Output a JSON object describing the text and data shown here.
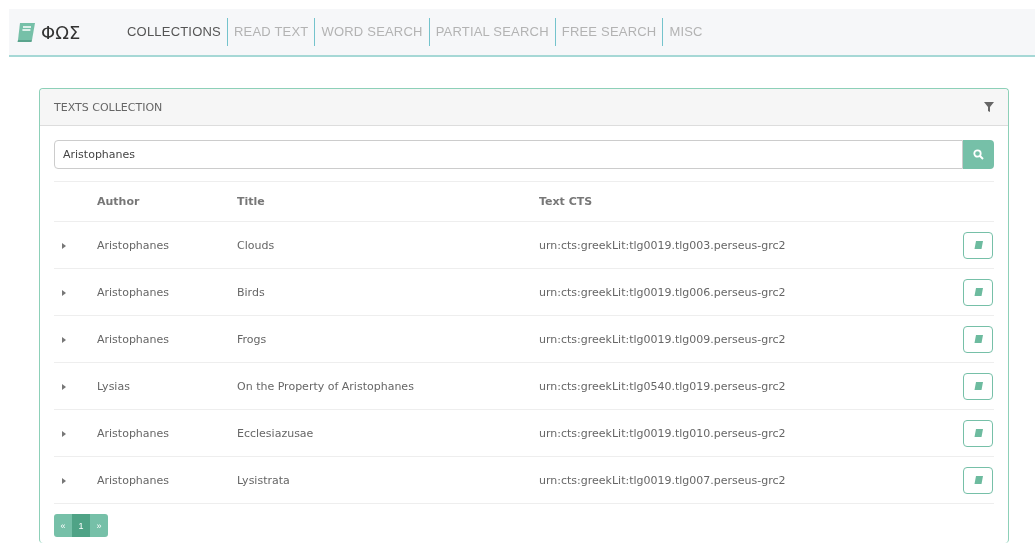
{
  "brand": {
    "title": "ΦΩΣ"
  },
  "nav": [
    {
      "label": "COLLECTIONS",
      "selected": true
    },
    {
      "label": "READ TEXT",
      "selected": false
    },
    {
      "label": "WORD SEARCH",
      "selected": false
    },
    {
      "label": "PARTIAL SEARCH",
      "selected": false
    },
    {
      "label": "FREE SEARCH",
      "selected": false
    },
    {
      "label": "MISC",
      "selected": false
    }
  ],
  "panel": {
    "title": "TEXTS COLLECTION"
  },
  "search": {
    "value": "Aristophanes"
  },
  "table": {
    "columns": [
      "Author",
      "Title",
      "Text CTS"
    ],
    "rows": [
      {
        "author": "Aristophanes",
        "title": "Clouds",
        "cts": "urn:cts:greekLit:tlg0019.tlg003.perseus-grc2"
      },
      {
        "author": "Aristophanes",
        "title": "Birds",
        "cts": "urn:cts:greekLit:tlg0019.tlg006.perseus-grc2"
      },
      {
        "author": "Aristophanes",
        "title": "Frogs",
        "cts": "urn:cts:greekLit:tlg0019.tlg009.perseus-grc2"
      },
      {
        "author": "Lysias",
        "title": "On the Property of Aristophanes",
        "cts": "urn:cts:greekLit:tlg0540.tlg019.perseus-grc2"
      },
      {
        "author": "Aristophanes",
        "title": "Ecclesiazusae",
        "cts": "urn:cts:greekLit:tlg0019.tlg010.perseus-grc2"
      },
      {
        "author": "Aristophanes",
        "title": "Lysistrata",
        "cts": "urn:cts:greekLit:tlg0019.tlg007.perseus-grc2"
      }
    ]
  },
  "pagination": {
    "prev": "«",
    "next": "»",
    "pages": [
      {
        "label": "1",
        "selected": true
      }
    ]
  }
}
